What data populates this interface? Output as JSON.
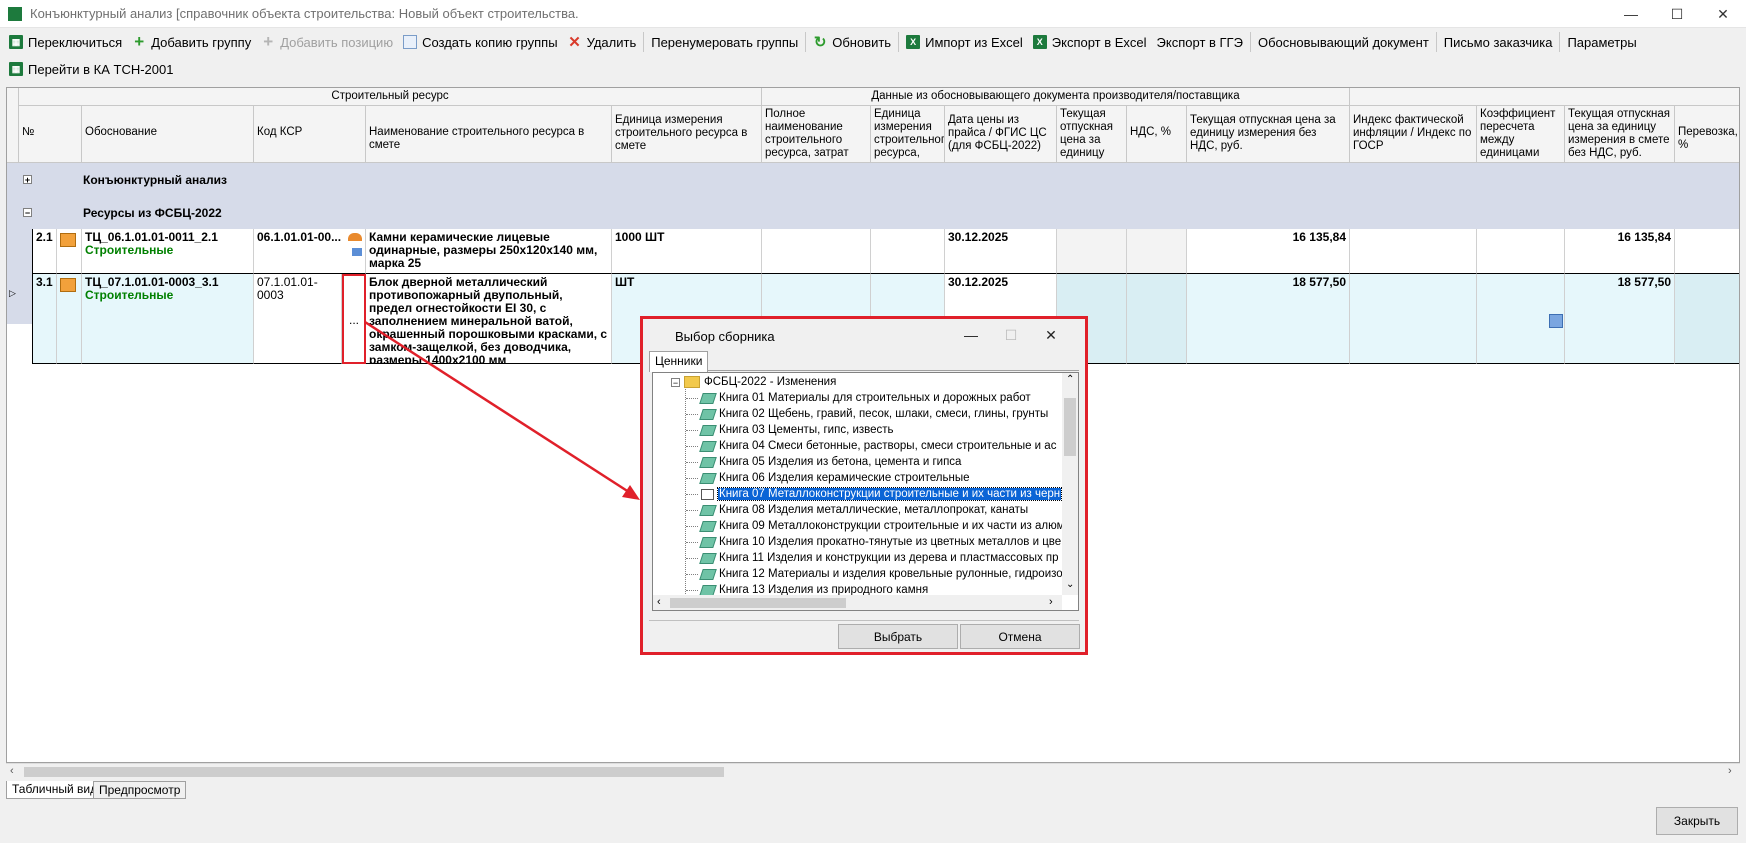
{
  "window": {
    "title": "Конъюнктурный анализ [справочник объекта строительства: Новый объект строительства.",
    "minimize": "—",
    "maximize": "☐",
    "close": "✕"
  },
  "toolbar1": {
    "switch": "Переключиться",
    "add_group": "Добавить группу",
    "add_position": "Добавить позицию",
    "copy_group": "Создать копию группы",
    "delete": "Удалить",
    "renumber": "Перенумеровать группы",
    "refresh": "Обновить",
    "import_excel": "Импорт из Excel",
    "export_excel": "Экспорт в Excel",
    "export_gge": "Экспорт в ГГЭ",
    "justify_doc": "Обосновывающий документ",
    "customer_letter": "Письмо заказчика",
    "params": "Параметры"
  },
  "toolbar2": {
    "goto_tsn": "Перейти в КА ТСН-2001"
  },
  "grid": {
    "band_resource": "Строительный ресурс",
    "band_supplier": "Данные из обосновывающего документа производителя/поставщика",
    "columns": {
      "num": "№",
      "basis": "Обоснование",
      "ksr": "Код КСР",
      "name": "Наименование строительного ресурса в смете",
      "unit": "Единица измерения строительного ресурса в смете",
      "full_name": "Полное наименование строительного ресурса, затрат",
      "unit2": "Единица измерения строительног ресурса,",
      "price_date": "Дата цены из прайса / ФГИС ЦС (для ФСБЦ-2022)",
      "cur_price": "Текущая отпускная цена за единицу",
      "vat": "НДС, %",
      "cur_price_novat": "Текущая отпускная цена за единицу измерения без НДС, руб.",
      "inflation": "Индекс фактической инфляции / Индекс по ГОСР",
      "coef": "Коэффициент пересчета между единицами",
      "cur_price_smeta": "Текущая отпускная цена за единицу измерения в смете без НДС, руб.",
      "transport": "Перевозка, %"
    },
    "groups": [
      {
        "toggle": "+",
        "name": "Конъюнктурный анализ"
      },
      {
        "toggle": "−",
        "name": "Ресурсы из ФСБЦ-2022"
      }
    ],
    "rows": [
      {
        "num": "2.1",
        "basis": "ТЦ_06.1.01.01-0011_2.1",
        "category": "Строительные",
        "ksr": "06.1.01.01-00...",
        "name": "Камни керамические лицевые одинарные, размеры 250х120х140 мм, марка 25",
        "unit": "1000 ШТ",
        "price_date": "30.12.2025",
        "cur_price_novat": "16 135,84",
        "cur_price_smeta": "16 135,84"
      },
      {
        "num": "3.1",
        "basis": "ТЦ_07.1.01.01-0003_3.1",
        "category": "Строительные",
        "ksr": "07.1.01.01-0003",
        "ellipsis": "...",
        "name": "Блок дверной металлический противопожарный двупольный, предел огнестойкости EI 30, с заполнением минеральной ватой, окрашенный порошковыми красками, с замком-защелкой, без доводчика, размеры 1400х2100 мм",
        "unit": "ШТ",
        "price_date": "30.12.2025",
        "cur_price_novat": "18 577,50",
        "cur_price_smeta": "18 577,50"
      }
    ]
  },
  "tabs": {
    "table": "Табличный вид",
    "preview": "Предпросмотр"
  },
  "close_button": "Закрыть",
  "dialog": {
    "title": "Выбор сборника",
    "tab": "Ценники",
    "root": "ФСБЦ-2022 - Изменения",
    "items": [
      "Книга 01 Материалы для строительных и дорожных работ",
      "Книга 02 Щебень, гравий, песок, шлаки, смеси, глины, грунты",
      "Книга 03 Цементы, гипс, известь",
      "Книга 04 Смеси бетонные, растворы, смеси строительные и ас",
      "Книга 05 Изделия из бетона, цемента и гипса",
      "Книга 06 Изделия керамические строительные",
      "Книга 07 Металлоконструкции строительные и их части из черн",
      "Книга 08 Изделия металлические, металлопрокат, канаты",
      "Книга 09 Металлоконструкции строительные и их части из алюм",
      "Книга 10 Изделия прокатно-тянутые из цветных металлов и цве",
      "Книга 11 Изделия и конструкции из дерева и пластмассовых пр",
      "Книга 12 Материалы и изделия кровельные рулонные, гидроизо",
      "Книга 13 Изделия из природного камня"
    ],
    "selected_index": 6,
    "select_button": "Выбрать",
    "cancel_button": "Отмена"
  },
  "colors": {
    "highlight": "#e0202a",
    "selection": "#0a64d6",
    "group_bg": "#d6dbe9",
    "row_selected_bg": "#e6f7fb"
  }
}
